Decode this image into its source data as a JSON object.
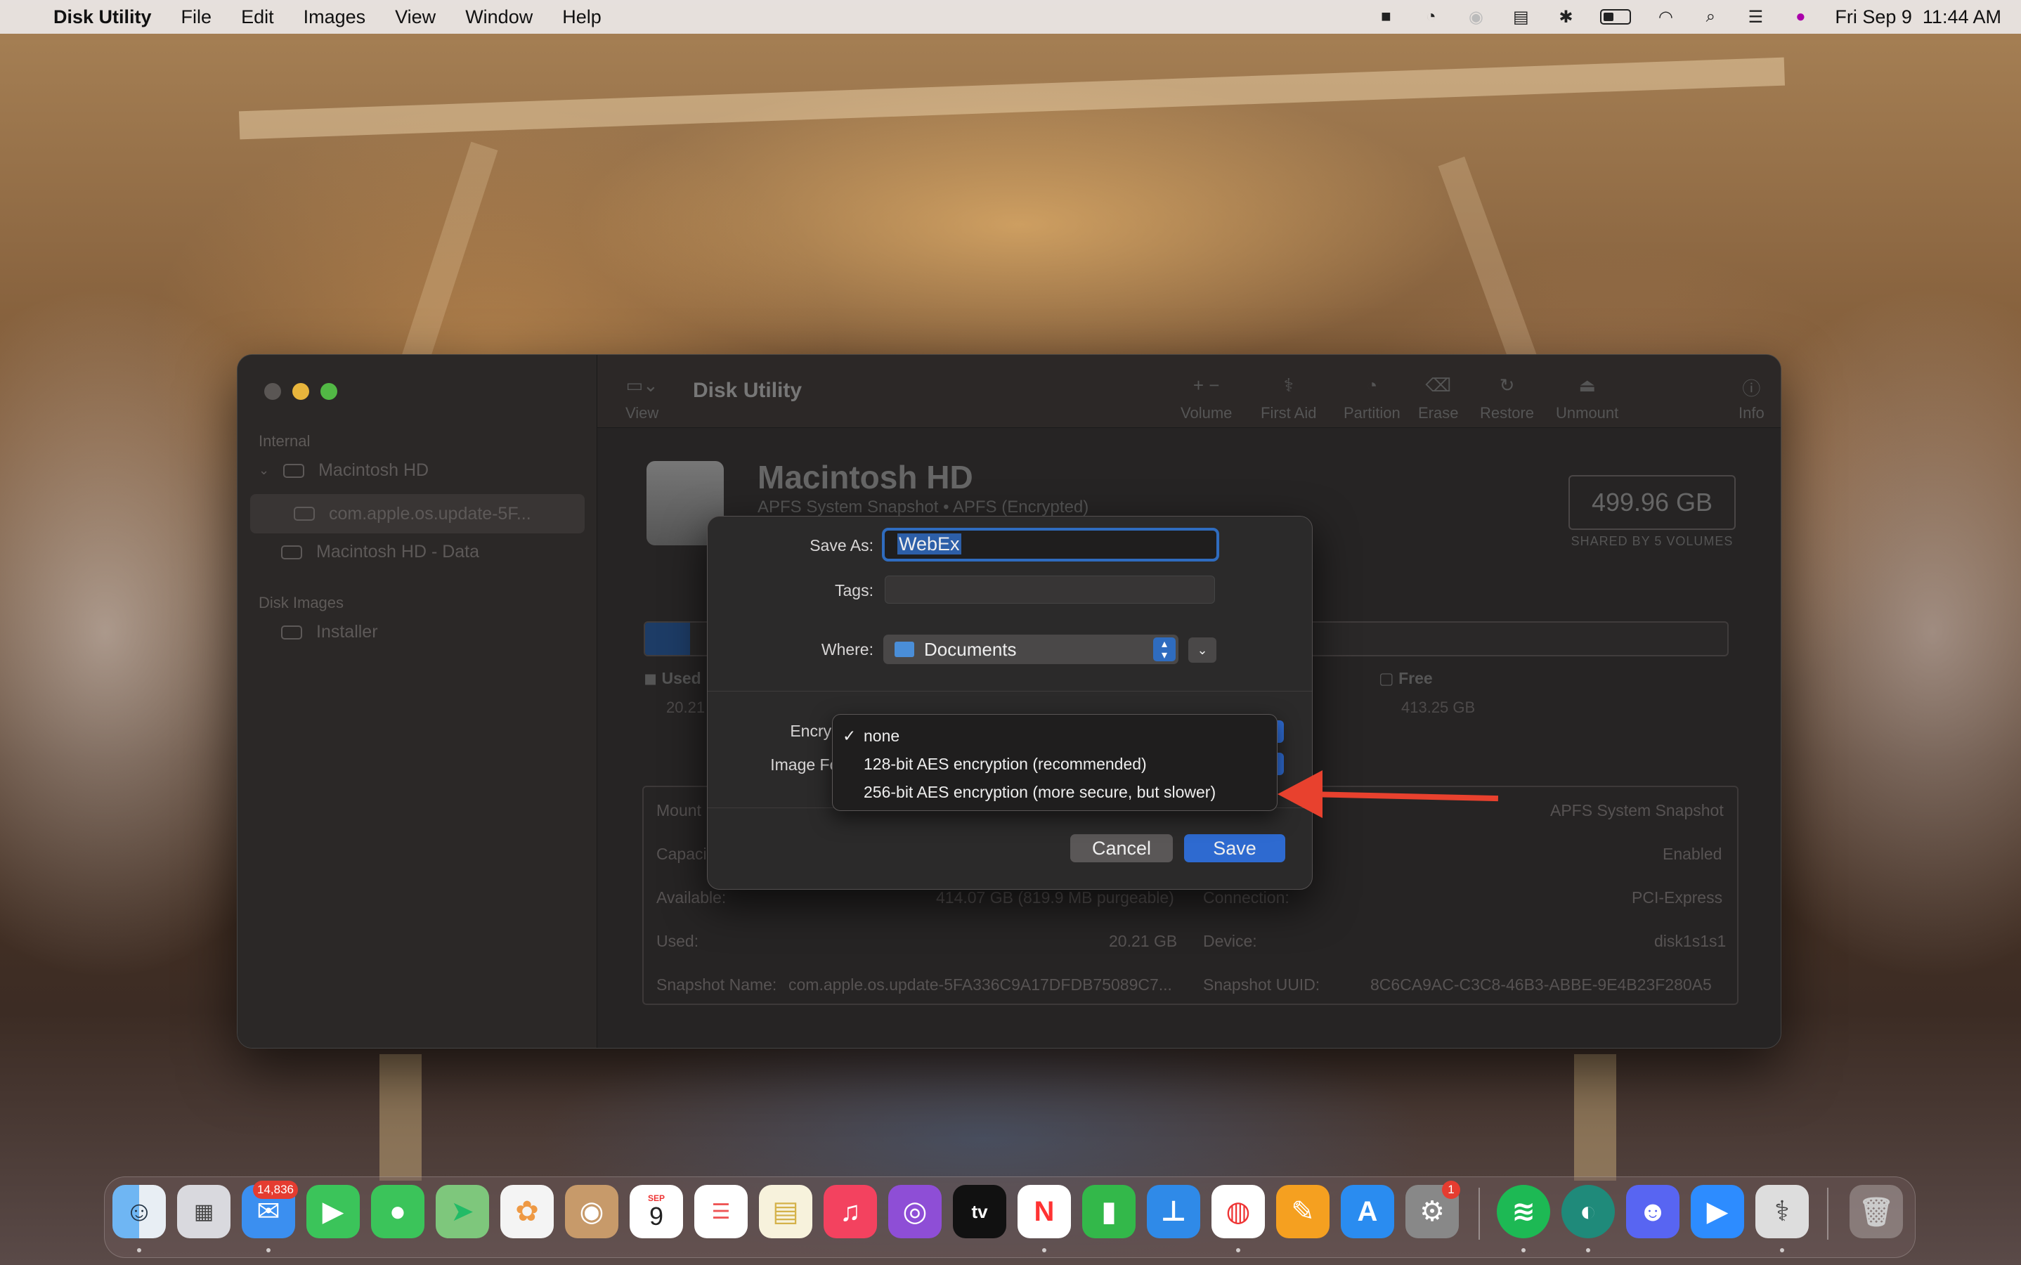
{
  "menubar": {
    "app": "Disk Utility",
    "items": [
      "File",
      "Edit",
      "Images",
      "View",
      "Window",
      "Help"
    ],
    "clock": "Fri Sep 9  11:44 AM",
    "status_icons": [
      "screen-record-icon",
      "creative-cloud-icon",
      "activity-icon",
      "calendar-icon",
      "bluetooth-icon",
      "battery-icon",
      "wifi-icon",
      "spotlight-icon",
      "control-center-icon",
      "siri-icon"
    ]
  },
  "window": {
    "title": "Disk Utility",
    "toolbar": {
      "view": "View",
      "volume": "Volume",
      "first_aid": "First Aid",
      "partition": "Partition",
      "erase": "Erase",
      "restore": "Restore",
      "unmount": "Unmount",
      "info": "Info"
    },
    "sidebar": {
      "internal": "Internal",
      "macintosh_hd": "Macintosh HD",
      "snapshot": "com.apple.os.update-5F...",
      "data": "Macintosh HD - Data",
      "disk_images": "Disk Images",
      "installer": "Installer"
    },
    "volume": {
      "name": "Macintosh HD",
      "subtitle": "APFS System Snapshot • APFS (Encrypted)",
      "capacity": "499.96 GB",
      "shared": "SHARED BY 5 VOLUMES",
      "used_label": "Used",
      "used_value": "20.21",
      "free_label": "Free",
      "free_value": "413.25 GB"
    },
    "info": {
      "mount_label": "Mount",
      "type_value": "APFS System Snapshot",
      "capacity_label": "Capaci",
      "owners_value": "Enabled",
      "available_label": "Available:",
      "available_value": "414.07 GB (819.9 MB purgeable)",
      "connection_label": "Connection:",
      "connection_value": "PCI-Express",
      "used_label": "Used:",
      "used_value": "20.21 GB",
      "device_label": "Device:",
      "device_value": "disk1s1s1",
      "snapshot_name_label": "Snapshot Name:",
      "snapshot_name_value": "com.apple.os.update-5FA336C9A17DFDB75089C7...",
      "snapshot_uuid_label": "Snapshot UUID:",
      "snapshot_uuid_value": "8C6CA9AC-C3C8-46B3-ABBE-9E4B23F280A5"
    }
  },
  "dialog": {
    "save_as_label": "Save As:",
    "save_as_value": "WebEx",
    "tags_label": "Tags:",
    "where_label": "Where:",
    "where_value": "Documents",
    "encryption_label": "Encryption",
    "image_format_label": "Image Forma",
    "cancel": "Cancel",
    "save": "Save"
  },
  "encryption_menu": {
    "selected": "none",
    "options": [
      "none",
      "128-bit AES encryption (recommended)",
      "256-bit AES encryption (more secure, but slower)"
    ]
  },
  "dock": {
    "mail_badge": "14,836",
    "settings_badge": "1",
    "calendar_month": "SEP",
    "calendar_day": "9",
    "apps": [
      "Finder",
      "Launchpad",
      "Mail",
      "FaceTime",
      "Messages",
      "Maps",
      "Photos",
      "Contacts",
      "Calendar",
      "Reminders",
      "Notes",
      "Music",
      "Podcasts",
      "TV",
      "News",
      "Numbers",
      "Keynote",
      "Chrome",
      "Pages",
      "App Store",
      "System Preferences",
      "Spotify",
      "Edge",
      "Discord",
      "Zoom",
      "Disk Utility",
      "Trash"
    ]
  },
  "colors": {
    "accent": "#2e6ad0",
    "annotation_arrow": "#e8412e"
  }
}
